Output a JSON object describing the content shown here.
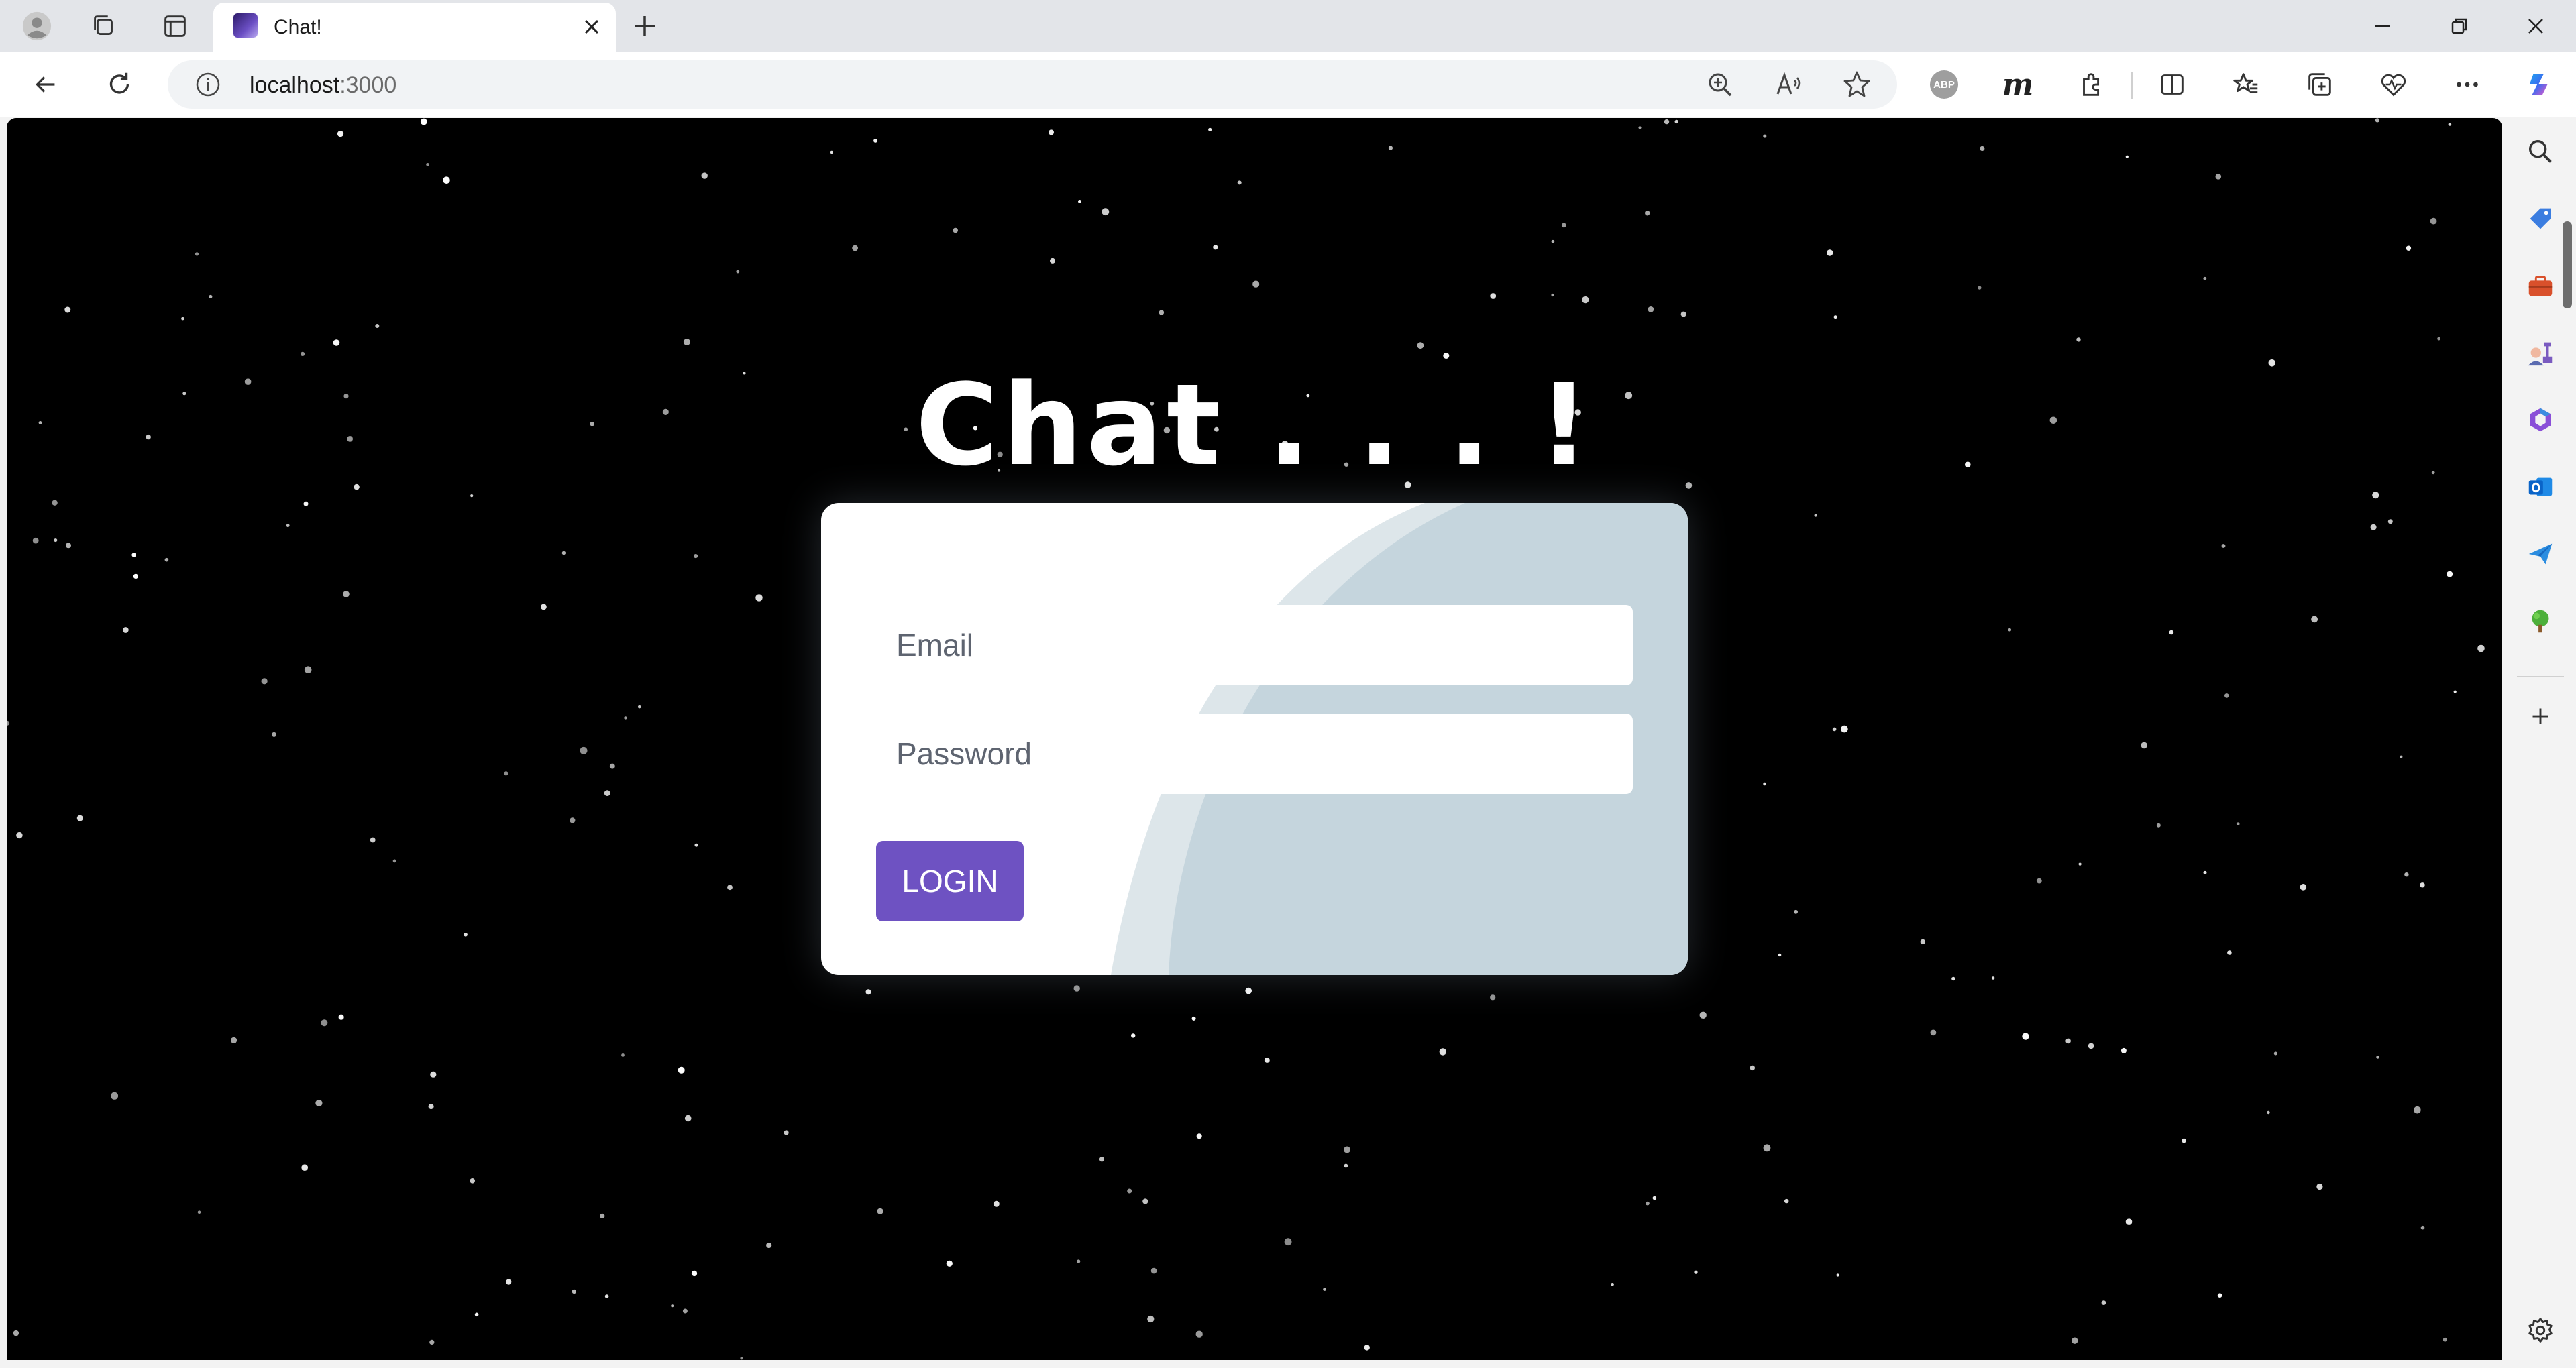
{
  "browser": {
    "tab": {
      "title": "Chat!"
    },
    "address": {
      "host": "localhost",
      "port": ":3000"
    },
    "colors": {
      "chrome_bg": "#e3e5e9",
      "toolbar_bg": "#ffffff",
      "address_bg": "#f1f3f5"
    },
    "icons": {
      "tabstrip": [
        "profile-icon",
        "workspaces-icon",
        "tab-actions-icon",
        "new-tab-icon"
      ],
      "window": [
        "minimize-icon",
        "restore-icon",
        "close-window-icon"
      ],
      "toolbar": [
        "back-icon",
        "refresh-icon",
        "info-icon",
        "zoom-icon",
        "read-aloud-icon",
        "favorite-star-icon",
        "adblock-plus-icon",
        "m-extension-icon",
        "extensions-icon",
        "split-screen-icon",
        "favorites-icon",
        "collections-icon",
        "browser-essentials-icon",
        "more-icon",
        "copilot-icon"
      ],
      "sidebar": [
        "search-icon",
        "shopping-icon",
        "tools-icon",
        "games-icon",
        "office-icon",
        "outlook-icon",
        "send-icon",
        "tree-icon",
        "add-icon",
        "settings-icon"
      ]
    },
    "adblock_label": "ABP",
    "m_label": "m"
  },
  "page": {
    "title": "Chat . . . !",
    "background": "#000000",
    "form": {
      "email_placeholder": "Email",
      "password_placeholder": "Password",
      "login_label": "LOGIN"
    },
    "colors": {
      "card_bg": "#ffffff",
      "deco": "#c5d5dd",
      "deco_light": "#dde6ea",
      "button": "#6e52c2",
      "button_text": "#ffffff"
    }
  }
}
